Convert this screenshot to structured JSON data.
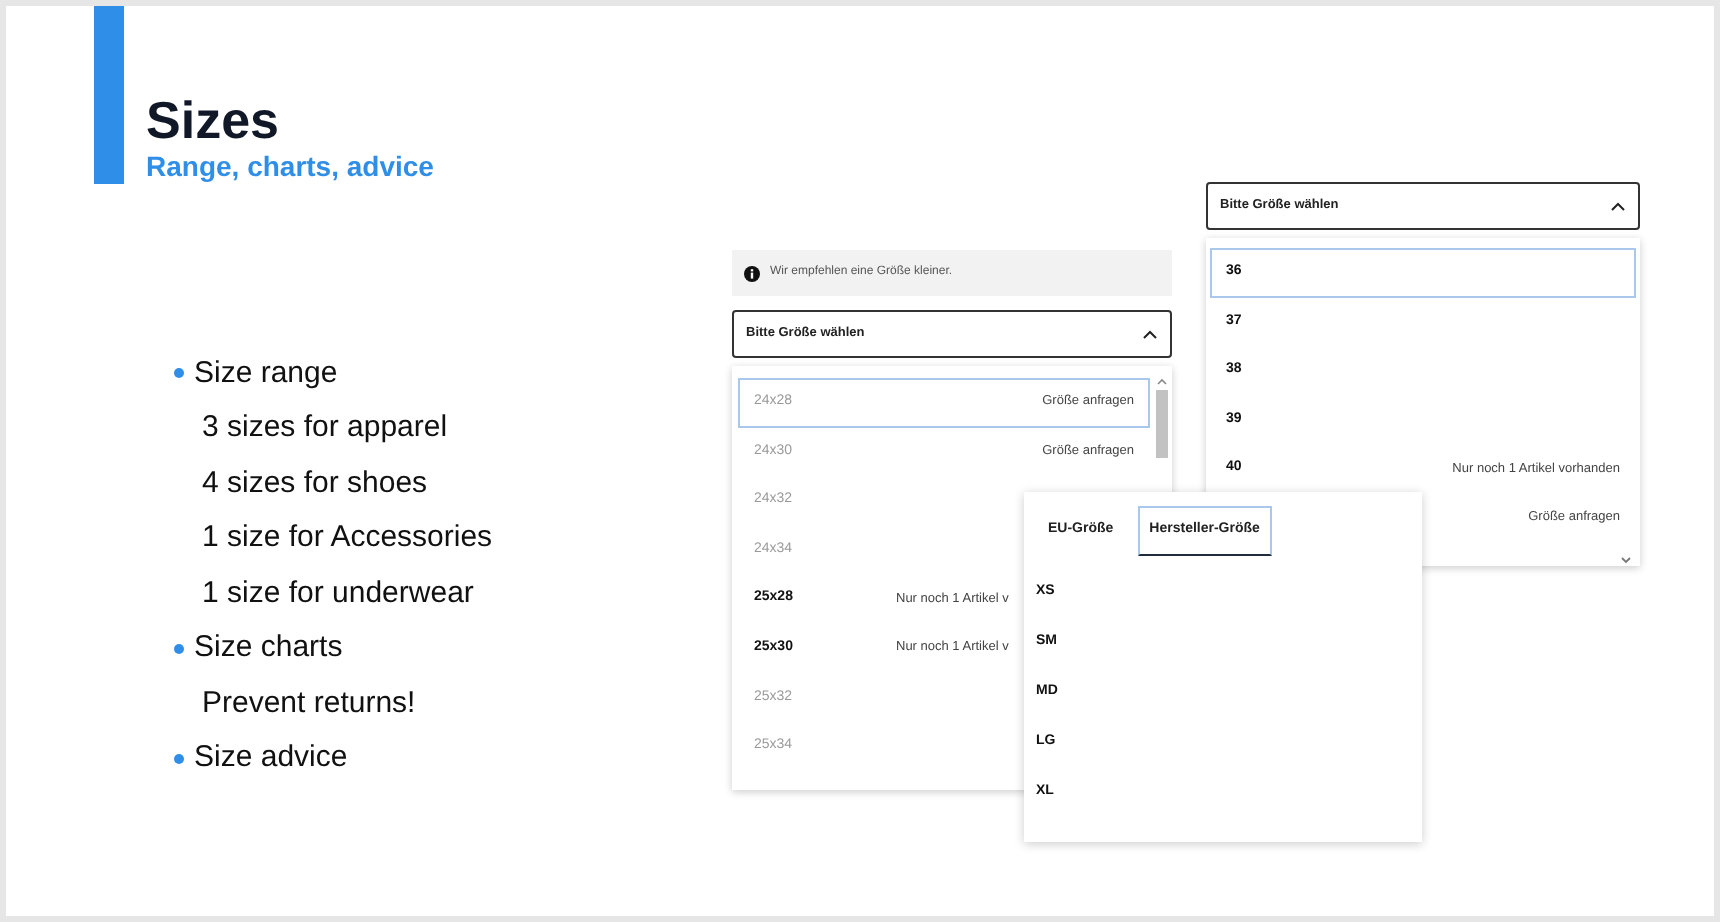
{
  "slide": {
    "title": "Sizes",
    "subtitle": "Range, charts, advice"
  },
  "bullets": [
    {
      "text": "Size range",
      "children": [
        {
          "text": "3 sizes for apparel"
        },
        {
          "text": "4 sizes for shoes"
        },
        {
          "text": "1 size for Accessories"
        },
        {
          "text": "1 size for underwear"
        }
      ]
    },
    {
      "text": "Size charts",
      "children": [
        {
          "text": "Prevent returns!"
        }
      ]
    },
    {
      "text": "Size advice"
    }
  ],
  "pants_selector": {
    "notice": "Wir empfehlen eine Größe kleiner.",
    "select": {
      "label": "Bitte Größe wählen",
      "expanded": true
    },
    "options": [
      {
        "size": "24x28",
        "note": "Größe anfragen",
        "kind": "request",
        "disabled": true,
        "selected": true
      },
      {
        "size": "24x30",
        "note": "Größe anfragen",
        "kind": "request",
        "disabled": true,
        "selected": false
      },
      {
        "size": "24x32",
        "disabled": true,
        "selected": false
      },
      {
        "size": "24x34",
        "disabled": true,
        "selected": false
      },
      {
        "size": "25x28",
        "note": "Nur noch 1 Artikel v",
        "kind": "stock",
        "disabled": false,
        "selected": false
      },
      {
        "size": "25x30",
        "note": "Nur noch 1 Artikel v",
        "kind": "stock",
        "disabled": false,
        "selected": false
      },
      {
        "size": "25x32",
        "disabled": true,
        "selected": false
      },
      {
        "size": "25x34",
        "disabled": true,
        "selected": false
      }
    ]
  },
  "shoe_selector": {
    "select": {
      "label": "Bitte Größe wählen",
      "expanded": true
    },
    "options": [
      {
        "size": "36",
        "selected": true
      },
      {
        "size": "37",
        "selected": false
      },
      {
        "size": "38",
        "selected": false
      },
      {
        "size": "39",
        "selected": false
      },
      {
        "size": "40",
        "note": "Nur noch 1 Artikel vorhanden",
        "selected": false
      },
      {
        "note": "Größe anfragen",
        "selected": false
      }
    ]
  },
  "size_chart": {
    "tabs": [
      {
        "label": "EU-Größe",
        "selected": false
      },
      {
        "label": "Hersteller-Größe",
        "selected": true
      }
    ],
    "sizes": [
      "XS",
      "SM",
      "MD",
      "LG",
      "XL"
    ]
  }
}
